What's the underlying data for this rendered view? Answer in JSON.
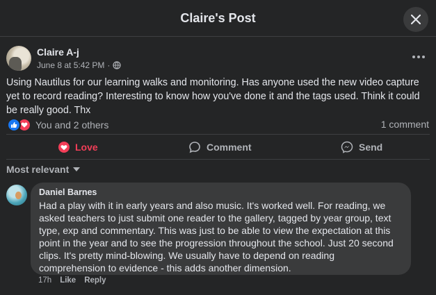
{
  "header": {
    "title": "Claire's Post",
    "close_icon": "close-icon"
  },
  "post": {
    "author": "Claire A-j",
    "timestamp": "June 8 at 5:42 PM",
    "separator": "·",
    "audience_icon": "globe-icon",
    "text": "Using Nautilus for our learning walks and monitoring. Has anyone used the new video capture yet to record reading? Interesting to know how you've done it and the tags used. Think it could be really good. Thx",
    "reactions": {
      "icons": [
        "like-icon",
        "love-icon"
      ],
      "summary": "You and 2 others"
    },
    "comment_count": "1 comment"
  },
  "actions": {
    "love": "Love",
    "comment": "Comment",
    "send": "Send"
  },
  "colors": {
    "background": "#242526",
    "bubble": "#3a3b3c",
    "love": "#f33e58",
    "like": "#1877f2",
    "secondary_text": "#b0b3b8"
  },
  "comments": {
    "sort_label": "Most relevant",
    "items": [
      {
        "author": "Daniel Barnes",
        "text": "Had a play with it in early years and also music. It's worked well. For reading, we asked teachers to just submit one reader to the gallery, tagged by year group, text type, exp and commentary. This was just to be able to view the expectation at this point in the year and to see the progression throughout the school. Just 20 second clips. It's pretty mind-blowing. We usually have to depend on reading comprehension to evidence - this adds another dimension.",
        "time": "17h",
        "like_label": "Like",
        "reply_label": "Reply"
      }
    ]
  }
}
